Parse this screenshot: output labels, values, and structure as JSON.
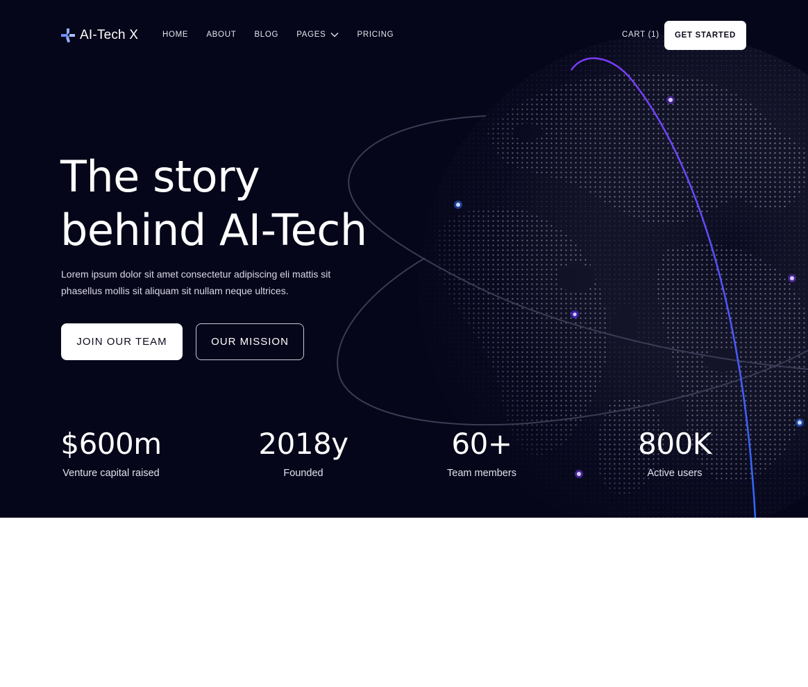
{
  "brand": {
    "name": "AI-Tech X"
  },
  "nav": {
    "links": [
      {
        "label": "HOME"
      },
      {
        "label": "ABOUT"
      },
      {
        "label": "BLOG"
      },
      {
        "label": "PAGES",
        "has_dropdown": true
      },
      {
        "label": "PRICING"
      }
    ],
    "cart_label": "CART (1)",
    "cta_label": "GET STARTED"
  },
  "hero": {
    "headline_line1": "The story",
    "headline_line2": "behind AI-Tech",
    "lead_line1": "Lorem ipsum dolor sit amet consectetur adipiscing eli mattis sit",
    "lead_line2": "phasellus mollis sit aliquam sit nullam neque ultrices.",
    "primary_button": "JOIN OUR TEAM",
    "secondary_button": "OUR MISSION"
  },
  "stats": [
    {
      "value": "$600m",
      "label": "Venture capital raised"
    },
    {
      "value": "2018y",
      "label": "Founded"
    },
    {
      "value": "60+",
      "label": "Team members"
    },
    {
      "value": "800K",
      "label": "Active users"
    }
  ],
  "icons": {
    "logo": "logo-mark-icon",
    "dropdown": "chevron-down-icon",
    "background": "dotted-globe-illustration"
  },
  "colors": {
    "hero_background": "#06061a",
    "accent_purple": "#7b3cff",
    "accent_blue": "#2f6bff",
    "text_primary": "#ffffff",
    "button_background": "#ffffff",
    "page_background": "#ffffff"
  }
}
